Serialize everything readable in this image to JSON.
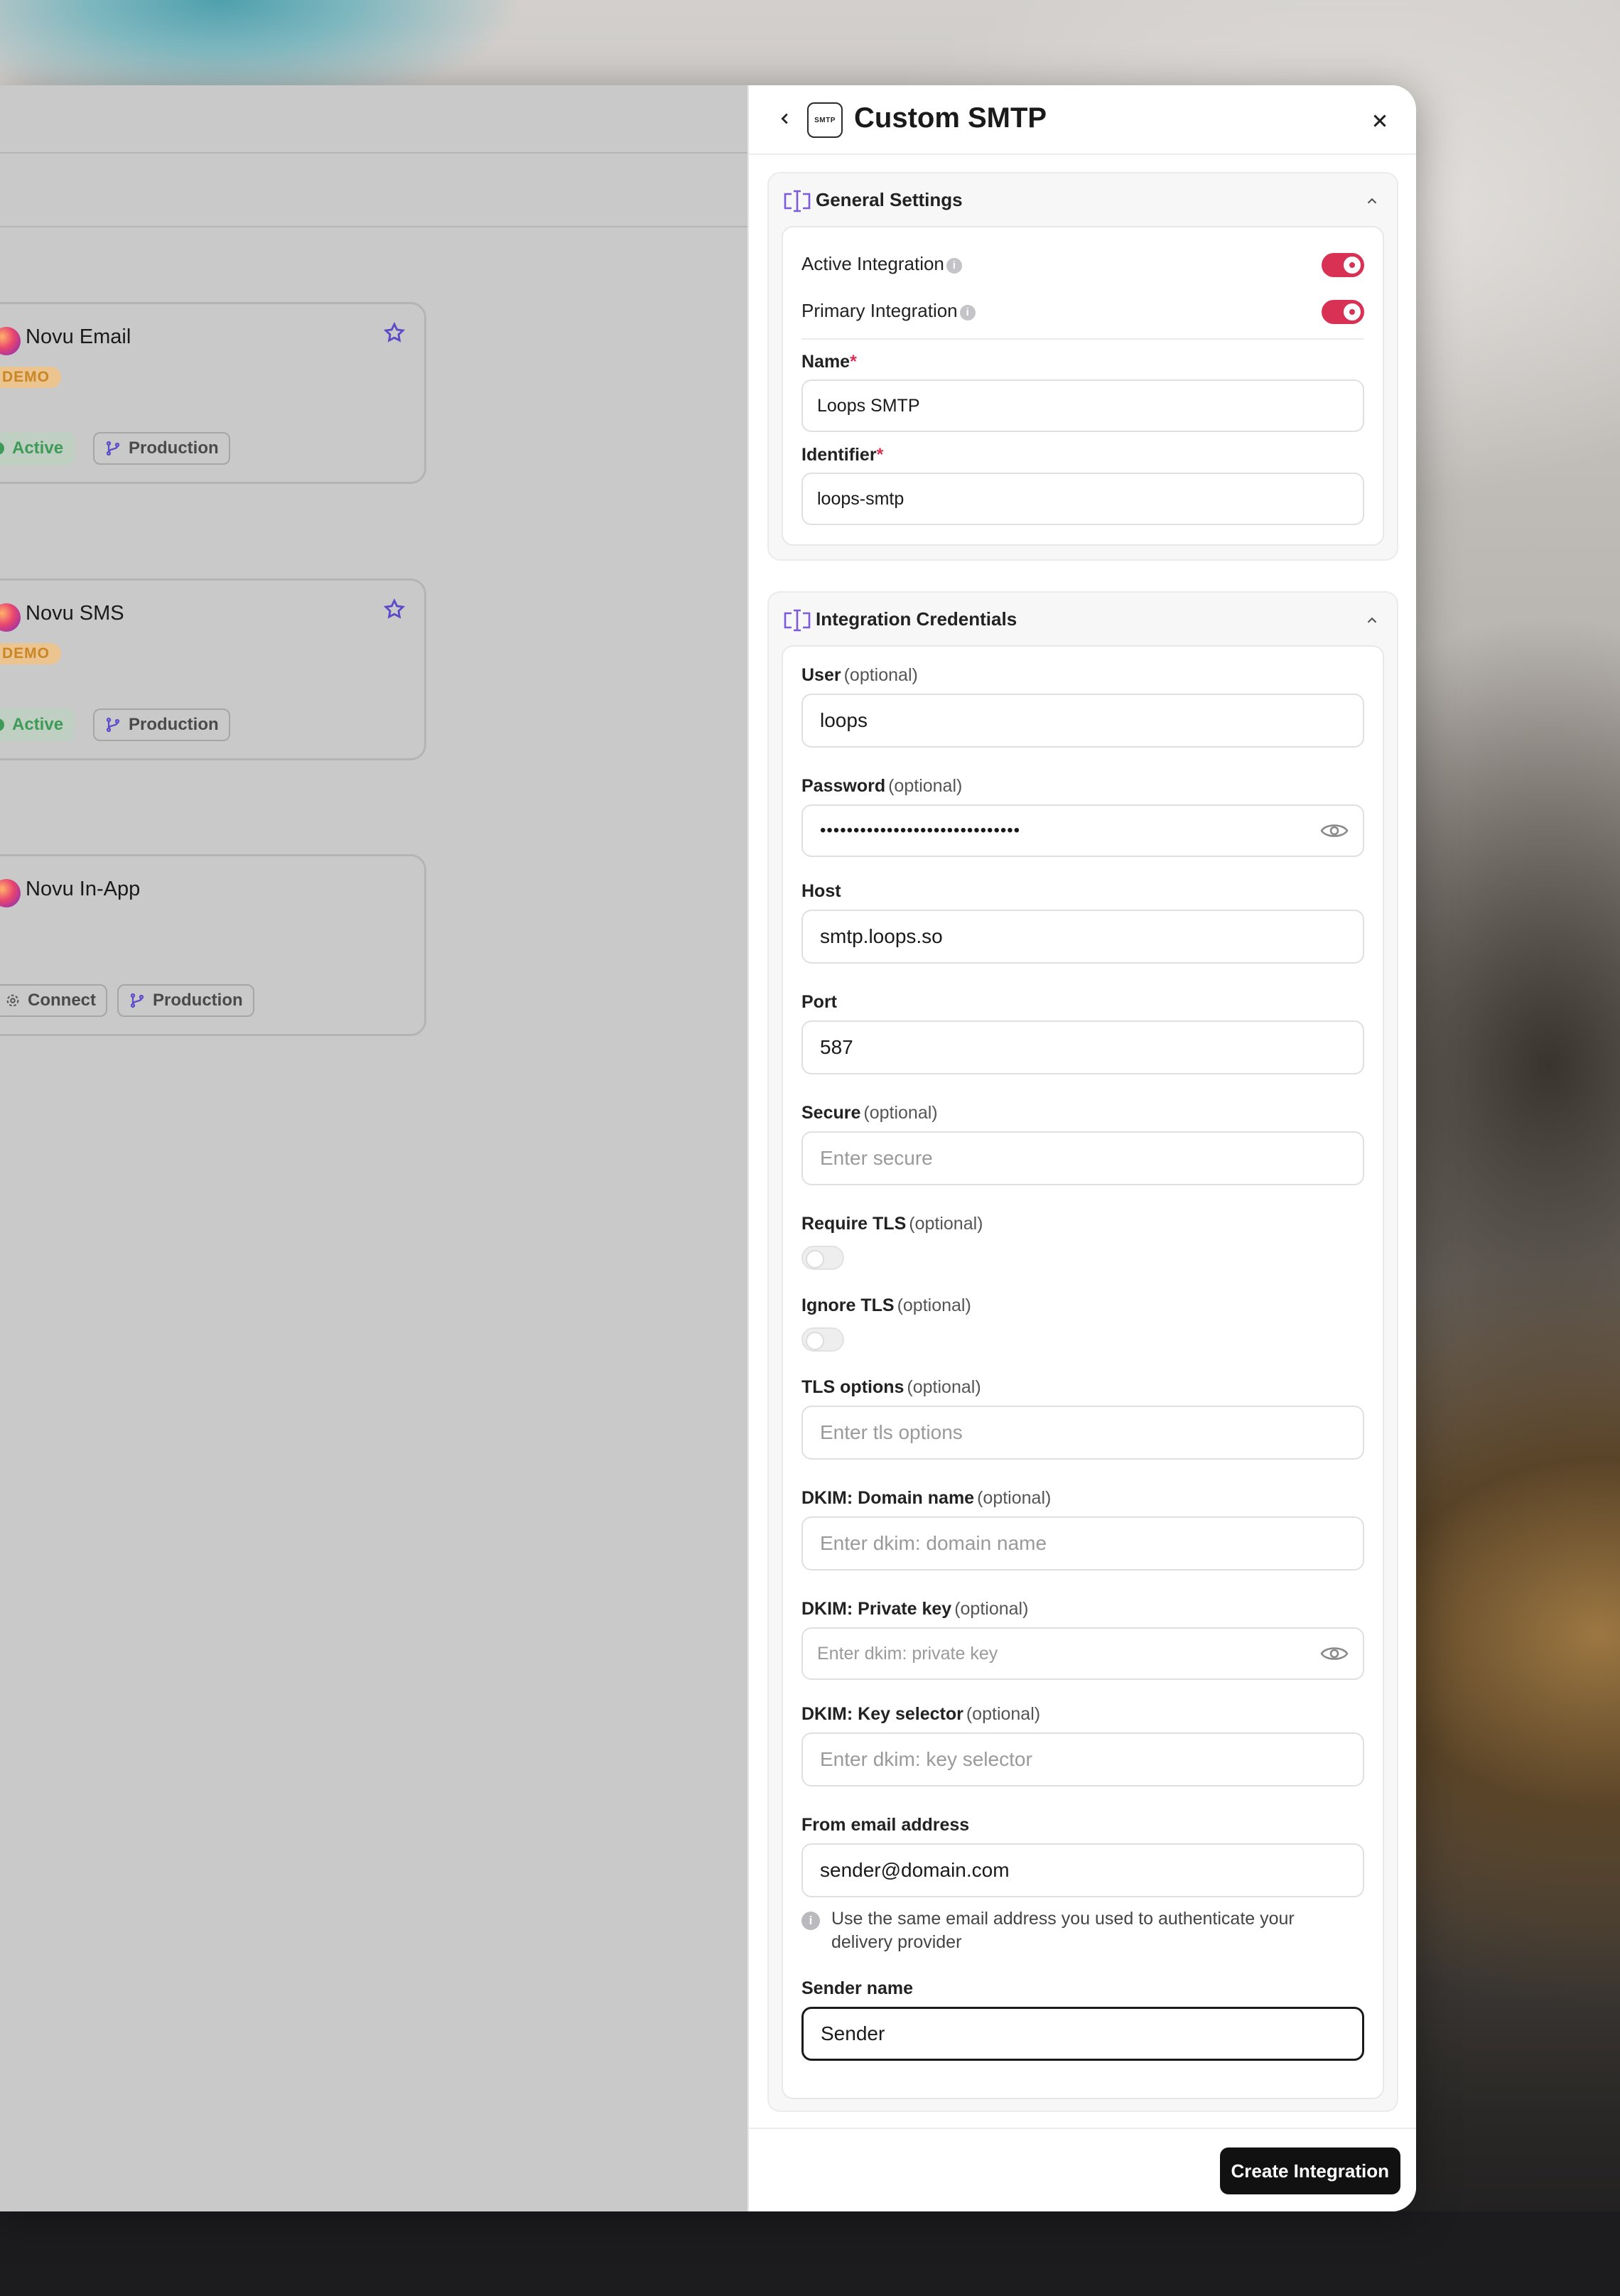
{
  "cards": [
    {
      "title": "Novu Email",
      "badge": "DEMO",
      "status": "Active",
      "environment": "Production"
    },
    {
      "title": "Novu SMS",
      "badge": "DEMO",
      "status": "Active",
      "environment": "Production"
    },
    {
      "title": "Novu In-App",
      "action": "Connect",
      "environment": "Production"
    }
  ],
  "drawer": {
    "logo_text": "SMTP",
    "title": "Custom SMTP",
    "general": {
      "title": "General Settings",
      "active_label": "Active Integration",
      "active_on": true,
      "primary_label": "Primary Integration",
      "primary_on": true,
      "name_label": "Name",
      "name_value": "Loops SMTP",
      "identifier_label": "Identifier",
      "identifier_value": "loops-smtp",
      "required_mark": "*"
    },
    "credentials": {
      "title": "Integration Credentials",
      "optional": "(optional)",
      "user_label": "User",
      "user_value": "loops",
      "password_label": "Password",
      "password_value": "••••••••••••••••••••••••••••••",
      "host_label": "Host",
      "host_value": "smtp.loops.so",
      "port_label": "Port",
      "port_value": "587",
      "secure_label": "Secure",
      "secure_placeholder": "Enter secure",
      "require_tls_label": "Require TLS",
      "require_tls_on": false,
      "ignore_tls_label": "Ignore TLS",
      "ignore_tls_on": false,
      "tls_options_label": "TLS options",
      "tls_options_placeholder": "Enter tls options",
      "dkim_domain_label": "DKIM: Domain name",
      "dkim_domain_placeholder": "Enter dkim: domain name",
      "dkim_key_label": "DKIM: Private key",
      "dkim_key_placeholder": "Enter dkim: private key",
      "dkim_selector_label": "DKIM: Key selector",
      "dkim_selector_placeholder": "Enter dkim: key selector",
      "from_label": "From email address",
      "from_value": "sender@domain.com",
      "from_hint": "Use the same email address you used to authenticate your delivery provider",
      "sender_label": "Sender name",
      "sender_value": "Sender"
    },
    "submit_label": "Create Integration"
  },
  "colors": {
    "accent": "#d93154",
    "primary_button": "#111111",
    "section_icon": "#7b5cd6",
    "active_green": "#3e9a57",
    "demo_orange": "#c98624"
  }
}
